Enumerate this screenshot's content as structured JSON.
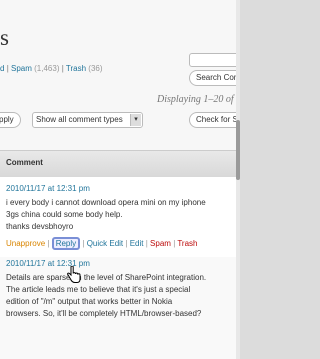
{
  "header": {
    "title": "s"
  },
  "filters": {
    "partial_label": "d",
    "separator": "|",
    "spam_label": "Spam",
    "spam_count": "(1,463)",
    "trash_label": "Trash",
    "trash_count": "(36)"
  },
  "search": {
    "button_label": "Search Com"
  },
  "pagination": {
    "displaying": "Displaying 1–20 of"
  },
  "bulk": {
    "apply_label": "pply",
    "select_value": "Show all comment types",
    "check_spam_label": "Check for Sp"
  },
  "table": {
    "column_header": "Comment"
  },
  "comments": [
    {
      "date": "2010/11/17 at 12:31 pm",
      "lines": [
        "i every body i cannot download opera mini on my iphone",
        "3gs china could some body help.",
        "thanks devsbhoyro"
      ],
      "actions": {
        "unapprove": "Unapprove",
        "reply": "Reply",
        "quick_edit": "Quick Edit",
        "edit": "Edit",
        "spam": "Spam",
        "trash": "Trash",
        "sep": "|"
      }
    },
    {
      "date": "2010/11/17 at 12:31 pm",
      "lines": [
        "Details are sparse on the level of SharePoint integration.",
        "The article leads me to believe that it's just a special",
        "edition of \"/m\" output that works better in Nokia",
        "browsers. So, it'll be completely HTML/browser-based?"
      ]
    }
  ],
  "colors": {
    "link": "#21759b",
    "unapprove": "#d98500",
    "danger": "#bc0b0b"
  }
}
